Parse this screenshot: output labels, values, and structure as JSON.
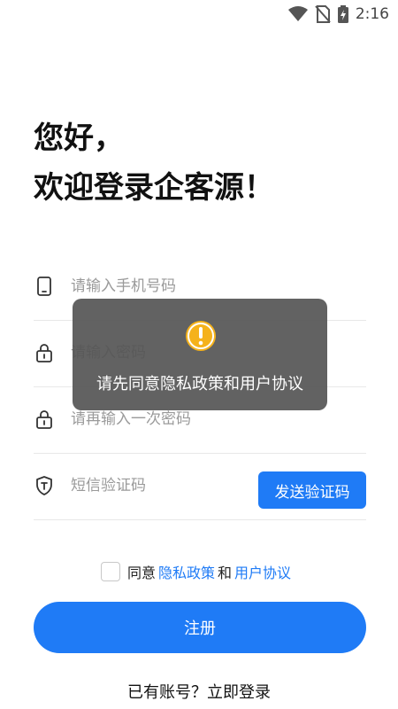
{
  "status_bar": {
    "time": "2:16"
  },
  "greeting": {
    "line1": "您好，",
    "line2": "欢迎登录企客源！"
  },
  "form": {
    "phone_placeholder": "请输入手机号码",
    "password_placeholder": "请输入密码",
    "confirm_password_placeholder": "请再输入一次密码",
    "sms_code_placeholder": "短信验证码",
    "send_code_label": "发送验证码"
  },
  "agreement": {
    "prefix": "同意",
    "privacy_policy": "隐私政策",
    "and": "和",
    "user_agreement": "用户协议",
    "checked": false
  },
  "register_label": "注册",
  "login_prompt": "已有账号？立即登录",
  "toast": {
    "message": "请先同意隐私政策和用户协议"
  },
  "colors": {
    "accent": "#1f7bf6",
    "warning": "#f5b21b"
  }
}
